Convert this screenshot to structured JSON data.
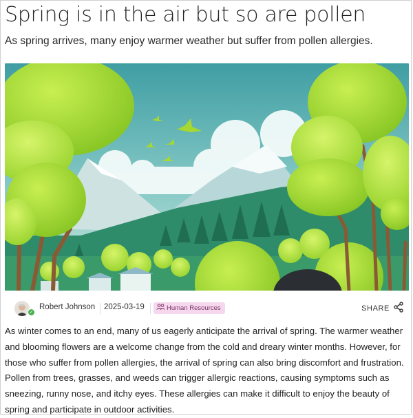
{
  "article": {
    "title": "Spring is in the air but so are pollen",
    "subtitle": "As spring arrives, many enjoy warmer weather but suffer from pollen allergies.",
    "hero_image": "spring landscape illustration with trees, mountains and birds",
    "author": "Robert Johnson",
    "date": "2025-03-19",
    "category": "Human Resources",
    "share_label": "SHARE",
    "body": "As winter comes to an end, many of us eagerly anticipate the arrival of spring. The warmer weather and blooming flowers are a welcome change from the cold and dreary winter months. However, for those who suffer from pollen allergies, the arrival of spring can also bring discomfort and frustration. Pollen from trees, grasses, and weeds can trigger allergic reactions, causing symptoms such as sneezing, runny nose, and itchy eyes. These allergies can make it difficult to enjoy the beauty of spring and participate in outdoor activities."
  },
  "icons": {
    "category": "people-icon",
    "share": "share-icon",
    "verified": "check-icon"
  },
  "colors": {
    "tag_background": "#f6d8ee",
    "tag_text": "#7a2f66",
    "verified": "#4caf50",
    "sky": "#5fb2b3",
    "foliage": "#9fd43a"
  }
}
